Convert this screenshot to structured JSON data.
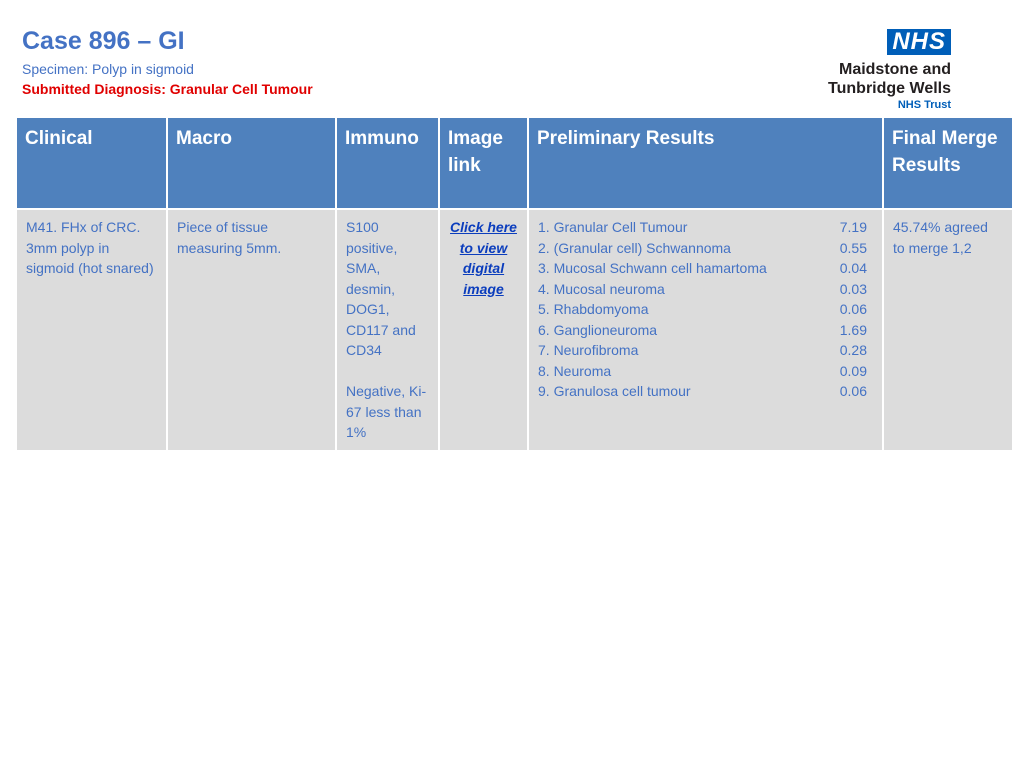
{
  "header": {
    "title": "Case 896 – GI",
    "specimen": "Specimen: Polyp in sigmoid",
    "submitted_diagnosis": "Submitted Diagnosis:  Granular Cell Tumour"
  },
  "logo": {
    "nhs": "NHS",
    "line1": "Maidstone and",
    "line2": "Tunbridge Wells",
    "trust": "NHS Trust"
  },
  "table": {
    "headers": {
      "clinical": "Clinical",
      "macro": "Macro",
      "immuno": "Immuno",
      "image_link": "Image link",
      "preliminary": "Preliminary Results",
      "final": "Final Merge Results"
    },
    "row": {
      "clinical": "M41. FHx of CRC. 3mm polyp in sigmoid (hot snared)",
      "macro": "Piece of tissue measuring 5mm.",
      "immuno_positive": "S100 positive, SMA, desmin, DOG1, CD117 and CD34",
      "immuno_negative": "Negative, Ki-67 less than 1%",
      "image_link": "Click here to view digital image",
      "preliminary": [
        {
          "label": "1. Granular Cell Tumour",
          "score": "7.19"
        },
        {
          "label": "2. (Granular cell) Schwannoma",
          "score": "0.55"
        },
        {
          "label": "3. Mucosal Schwann cell hamartoma",
          "score": "0.04"
        },
        {
          "label": "4. Mucosal neuroma",
          "score": "0.03"
        },
        {
          "label": "5. Rhabdomyoma",
          "score": "0.06"
        },
        {
          "label": "6. Ganglioneuroma",
          "score": "1.69"
        },
        {
          "label": "7. Neurofibroma",
          "score": "0.28"
        },
        {
          "label": "8. Neuroma",
          "score": "0.09"
        },
        {
          "label": "9. Granulosa cell tumour",
          "score": "0.06"
        }
      ],
      "final": "45.74% agreed to merge 1,2"
    }
  }
}
